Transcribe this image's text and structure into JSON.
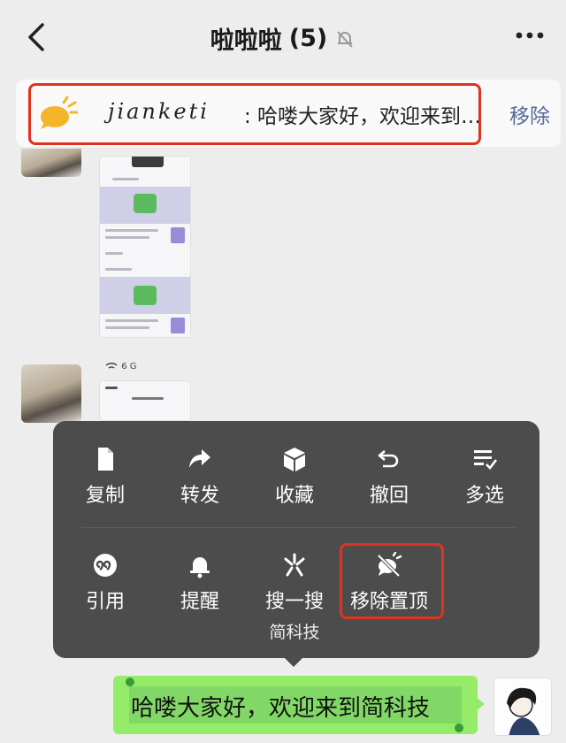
{
  "nav": {
    "title": "啦啦啦",
    "count": "(5)",
    "back_icon": "chevron-left-icon",
    "mute_icon": "bell-muted-icon",
    "more_icon": "more-dots-icon"
  },
  "pinned": {
    "icon": "pin-speech-icon",
    "sender": "jianketi",
    "message": ": 哈喽大家好，欢迎来到…",
    "remove_label": "移除"
  },
  "chat": {
    "status_text": "6 G"
  },
  "menu": {
    "row1": [
      {
        "label": "复制",
        "icon": "document-icon"
      },
      {
        "label": "转发",
        "icon": "forward-icon"
      },
      {
        "label": "收藏",
        "icon": "cube-icon"
      },
      {
        "label": "撤回",
        "icon": "undo-icon"
      },
      {
        "label": "多选",
        "icon": "multi-select-icon"
      }
    ],
    "row2": [
      {
        "label": "引用",
        "icon": "quote-icon"
      },
      {
        "label": "提醒",
        "icon": "bell-icon"
      },
      {
        "label": "搜一搜",
        "sub": "简科技",
        "icon": "search-spark-icon"
      },
      {
        "label": "移除置顶",
        "icon": "unpin-icon"
      }
    ]
  },
  "bubble": {
    "text": "哈喽大家好，欢迎来到简科技"
  },
  "colors": {
    "highlight": "#e0331f",
    "bubble": "#95ec69",
    "menu_bg": "#4c4c4c",
    "link": "#576b95"
  }
}
